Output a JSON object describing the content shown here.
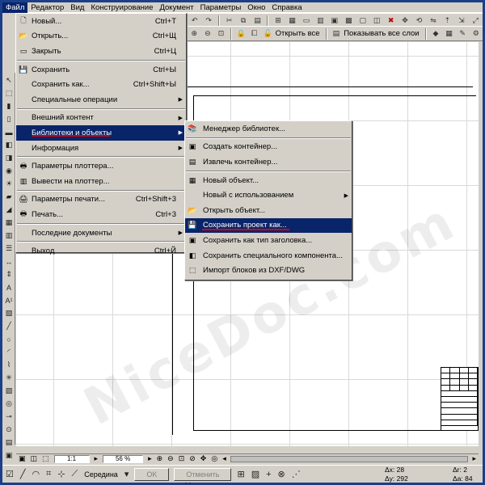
{
  "menubar": {
    "items": [
      {
        "label": "Файл",
        "active": true
      },
      {
        "label": "Редактор"
      },
      {
        "label": "Вид"
      },
      {
        "label": "Конструирование"
      },
      {
        "label": "Документ"
      },
      {
        "label": "Параметры"
      },
      {
        "label": "Окно"
      },
      {
        "label": "Справка"
      }
    ]
  },
  "toolbar": {
    "open_all": "Открыть все",
    "show_all_layers": "Показывать все слои"
  },
  "file_menu": {
    "items": [
      {
        "label": "Новый...",
        "shortcut": "Ctrl+T"
      },
      {
        "label": "Открыть...",
        "shortcut": "Ctrl+Щ"
      },
      {
        "label": "Закрыть",
        "shortcut": "Ctrl+Ц"
      },
      {
        "label": "Сохранить",
        "shortcut": "Ctrl+Ы"
      },
      {
        "label": "Сохранить как...",
        "shortcut": "Ctrl+Shift+Ы"
      },
      {
        "label": "Специальные операции"
      },
      {
        "label": "Внешний контент"
      },
      {
        "label": "Библиотеки и объекты"
      },
      {
        "label": "Информация"
      },
      {
        "label": "Параметры плоттера..."
      },
      {
        "label": "Вывести на плоттер..."
      },
      {
        "label": "Параметры печати...",
        "shortcut": "Ctrl+Shift+3"
      },
      {
        "label": "Печать...",
        "shortcut": "Ctrl+3"
      },
      {
        "label": "Последние документы"
      },
      {
        "label": "Выход",
        "shortcut": "Ctrl+Й"
      }
    ]
  },
  "library_submenu": {
    "items": [
      {
        "label": "Менеджер библиотек..."
      },
      {
        "label": "Создать контейнер..."
      },
      {
        "label": "Извлечь контейнер..."
      },
      {
        "label": "Новый объект..."
      },
      {
        "label": "Новый с использованием"
      },
      {
        "label": "Открыть объект..."
      },
      {
        "label": "Сохранить проект как..."
      },
      {
        "label": "Сохранить как тип заголовка..."
      },
      {
        "label": "Сохранить специального компонента..."
      },
      {
        "label": "Импорт блоков из DXF/DWG"
      }
    ]
  },
  "statusbar": {
    "scale": "1:1",
    "zoom": "56 %"
  },
  "ctrlbar": {
    "snap_label": "Середина",
    "ok_label": "OK",
    "cancel_label": "Отменить",
    "dx": "Δx: 28",
    "dy": "Δy: 292",
    "angle": "Δr: 2",
    "da": "Δa: 84"
  },
  "watermark": "NiceDoc.com"
}
